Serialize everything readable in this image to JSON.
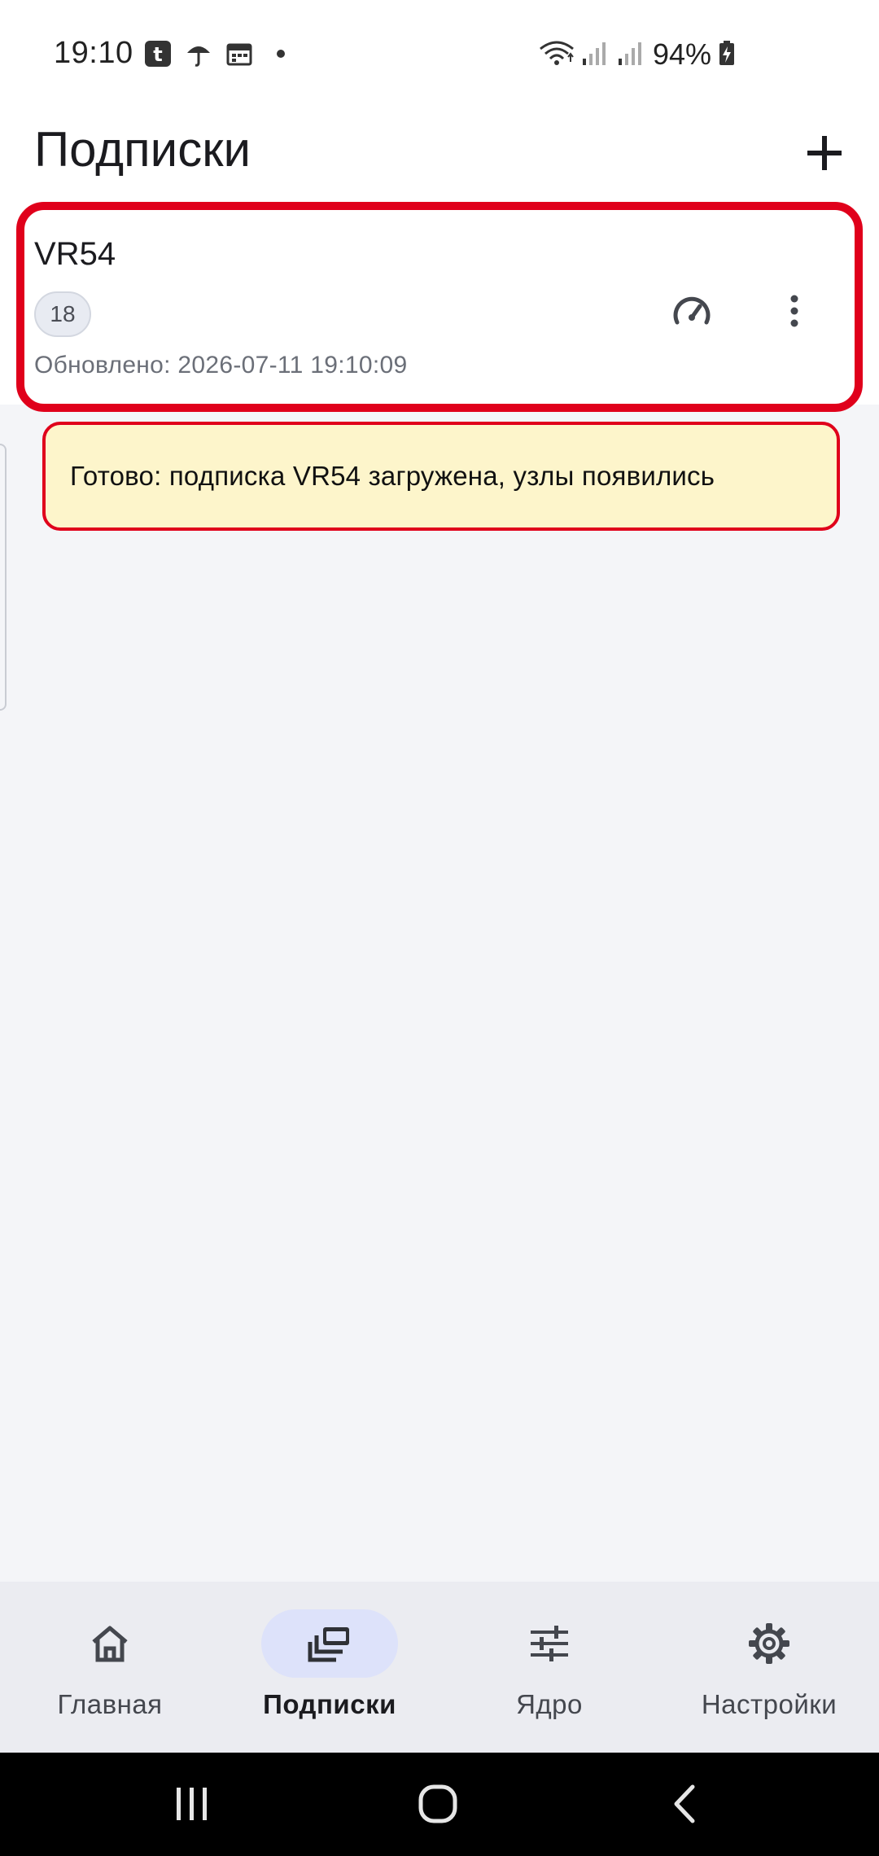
{
  "status_bar": {
    "time": "19:10",
    "battery_text": "94%",
    "icons_left": [
      "tumblr-icon",
      "umbrella-icon",
      "calendar-icon",
      "dot-icon"
    ],
    "icons_right": [
      "wifi-icon",
      "signal-icon",
      "signal-icon",
      "battery-charging-icon"
    ]
  },
  "header": {
    "title": "Подписки",
    "add_icon": "plus-icon"
  },
  "subscription": {
    "name": "VR54",
    "count": "18",
    "updated": "Обновлено: 2026-07-11 19:10:09",
    "speed_icon": "speedometer-icon",
    "more_icon": "more-vertical-icon"
  },
  "toast": {
    "text": "Готово: подписка VR54 загружена, узлы появились"
  },
  "bottom_nav": {
    "items": [
      {
        "label": "Главная",
        "icon": "home-icon",
        "active": false
      },
      {
        "label": "Подписки",
        "icon": "subscriptions-icon",
        "active": true
      },
      {
        "label": "Ядро",
        "icon": "sliders-icon",
        "active": false
      },
      {
        "label": "Настройки",
        "icon": "gear-icon",
        "active": false
      }
    ]
  },
  "colors": {
    "highlight": "#e0001b",
    "toast_bg": "#fdf5cb",
    "nav_active_pill": "#dde2fa",
    "page_bg": "#f4f5f8"
  }
}
